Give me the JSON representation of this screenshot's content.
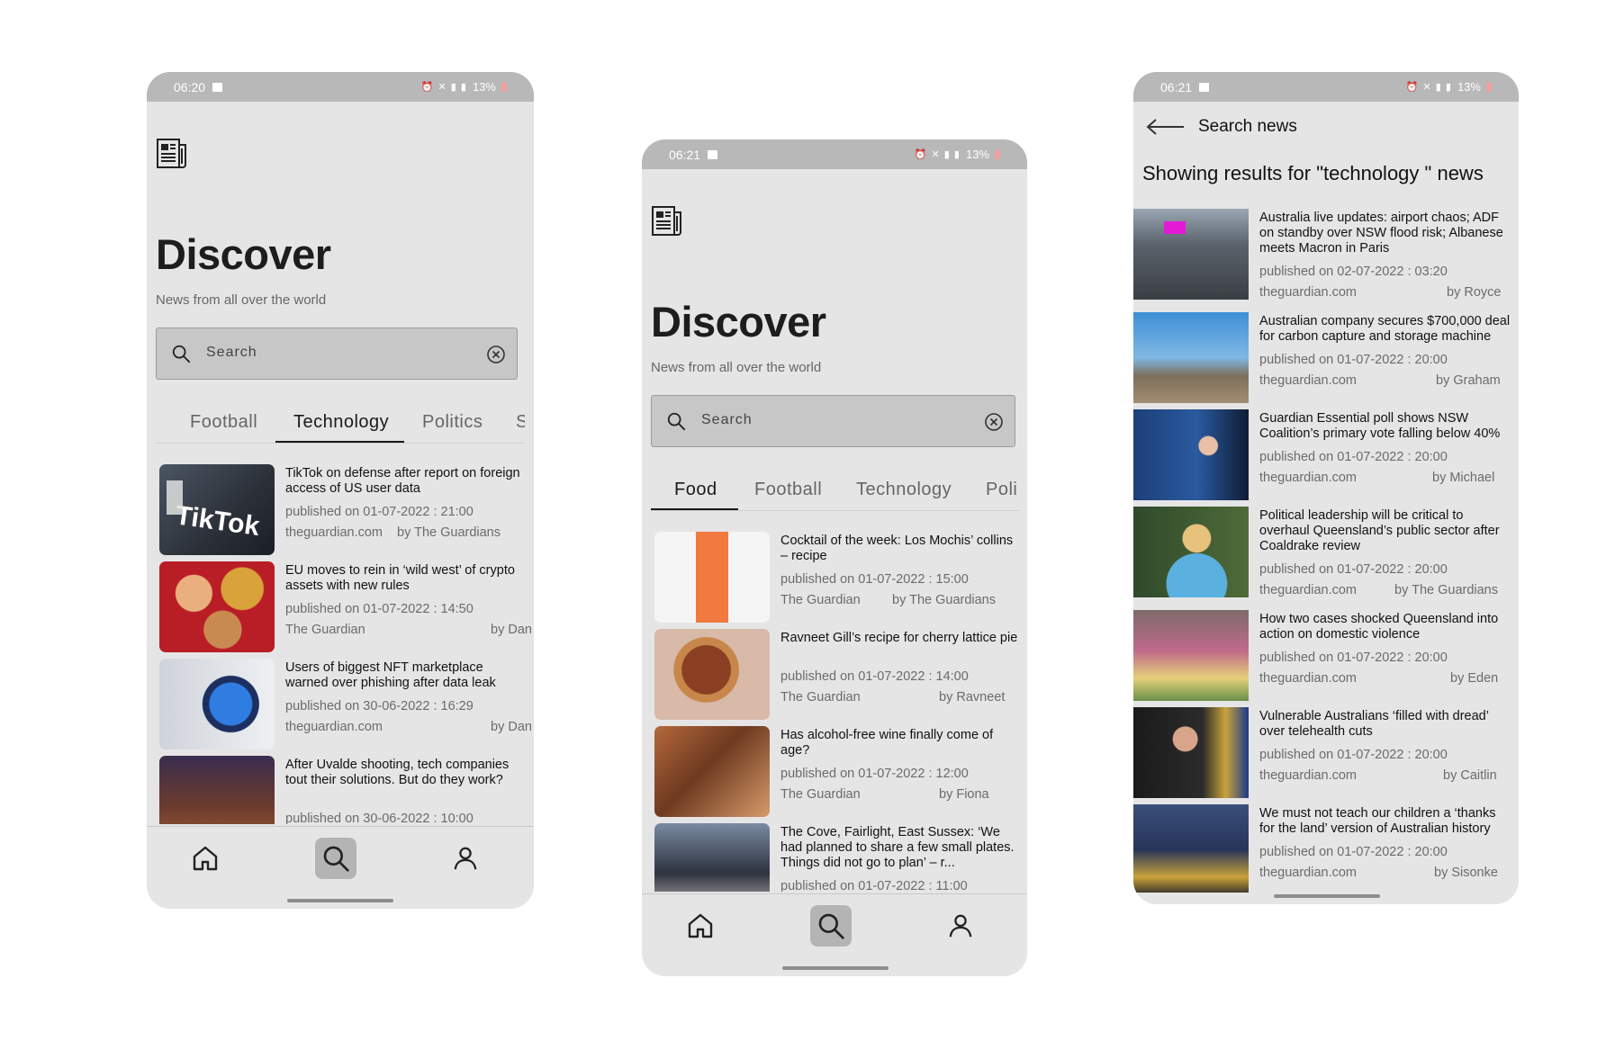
{
  "phone1": {
    "status": {
      "time": "06:20",
      "battery": "13%"
    },
    "title": "Discover",
    "subtitle": "News from all over the world",
    "search_placeholder": "Search",
    "tabs": [
      "Football",
      "Technology",
      "Politics",
      "S"
    ],
    "active_tab": "Technology",
    "articles": [
      {
        "title": "TikTok on defense after report on foreign access of US user data",
        "published": "published on 01-07-2022 : 21:00",
        "source": "theguardian.com",
        "author": "by The Guardians"
      },
      {
        "title": "EU moves to rein in ‘wild west’ of crypto assets with new rules",
        "published": "published on 01-07-2022 : 14:50",
        "source": "The Guardian",
        "author": "by Dan"
      },
      {
        "title": "Users of biggest NFT marketplace warned over phishing after data leak",
        "published": "published on 30-06-2022 : 16:29",
        "source": "theguardian.com",
        "author": "by Dan"
      },
      {
        "title": "After Uvalde shooting, tech companies tout their solutions. But do they work?",
        "published": "published on 30-06-2022 : 10:00",
        "source": "",
        "author": ""
      }
    ]
  },
  "phone2": {
    "status": {
      "time": "06:21",
      "battery": "13%"
    },
    "title": "Discover",
    "subtitle": "News from all over the world",
    "search_placeholder": "Search",
    "tabs": [
      "Food",
      "Football",
      "Technology",
      "Poli"
    ],
    "active_tab": "Food",
    "articles": [
      {
        "title": "Cocktail of the week: Los Mochis’ collins – recipe",
        "published": "published on 01-07-2022 : 15:00",
        "source": "The Guardian",
        "author": "by The Guardians"
      },
      {
        "title": "Ravneet Gill’s recipe for cherry lattice pie",
        "published": "published on 01-07-2022 : 14:00",
        "source": "The Guardian",
        "author": "by Ravneet"
      },
      {
        "title": "Has alcohol-free wine finally come of age?",
        "published": "published on 01-07-2022 : 12:00",
        "source": "The Guardian",
        "author": "by Fiona"
      },
      {
        "title": "The Cove, Fairlight, East Sussex: ‘We had planned to share a few small plates. Things did not go to plan’ – r...",
        "published": "published on 01-07-2022 : 11:00",
        "source": "",
        "author": ""
      }
    ]
  },
  "phone3": {
    "status": {
      "time": "06:21",
      "battery": "13%"
    },
    "header": "Search news",
    "results_title": "Showing results for \"technology \" news",
    "articles": [
      {
        "title": "Australia live updates: airport chaos; ADF on standby over NSW flood risk; Albanese meets Macron in Paris",
        "published": "published on 02-07-2022 : 03:20",
        "source": "theguardian.com",
        "author": "by Royce"
      },
      {
        "title": "Australian company secures $700,000 deal for carbon capture and storage machine",
        "published": "published on 01-07-2022 : 20:00",
        "source": "theguardian.com",
        "author": "by Graham"
      },
      {
        "title": "Guardian Essential poll shows NSW Coalition’s primary vote falling below 40%",
        "published": "published on 01-07-2022 : 20:00",
        "source": "theguardian.com",
        "author": "by Michael"
      },
      {
        "title": "Political leadership will be critical to overhaul Queensland’s public sector after Coaldrake review",
        "published": "published on 01-07-2022 : 20:00",
        "source": "theguardian.com",
        "author": "by The Guardians"
      },
      {
        "title": "How two cases shocked Queensland into action on domestic violence",
        "published": "published on 01-07-2022 : 20:00",
        "source": "theguardian.com",
        "author": "by Eden"
      },
      {
        "title": "Vulnerable Australians ‘filled with dread’ over telehealth cuts",
        "published": "published on 01-07-2022 : 20:00",
        "source": "theguardian.com",
        "author": "by Caitlin"
      },
      {
        "title": "We must not teach our children a ‘thanks for the land’ version of Australian history",
        "published": "published on 01-07-2022 : 20:00",
        "source": "theguardian.com",
        "author": "by Sisonke"
      }
    ]
  },
  "nav": [
    "home-icon",
    "search-icon",
    "profile-icon"
  ]
}
